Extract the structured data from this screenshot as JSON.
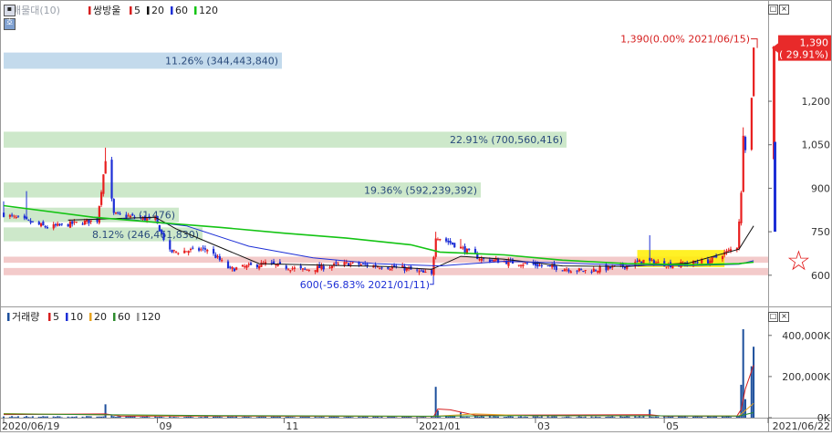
{
  "chart_data": [
    {
      "type": "candlestick",
      "panel": "price",
      "legend": [
        {
          "label": "매물대(10)",
          "color": "#9aa0aa"
        },
        {
          "label": "쌍방울",
          "color": "#d61f1f"
        },
        {
          "label": "5",
          "color": "#d61f1f"
        },
        {
          "label": "20",
          "color": "#111111"
        },
        {
          "label": "60",
          "color": "#1d2fd6"
        },
        {
          "label": "120",
          "color": "#14c414"
        }
      ],
      "y_axis": {
        "ticks": [
          600,
          750,
          900,
          1050,
          1200
        ],
        "tick_labels": [
          "600",
          "750",
          "900",
          "1,050",
          "1,200"
        ],
        "ylim": [
          505,
          1480
        ]
      },
      "x_axis": {
        "range": [
          "2020/06/19",
          "2021/06/22"
        ],
        "ticks": [
          {
            "date": "2020/06/19",
            "label": "2020/06/19"
          },
          {
            "date": "2020/09/01",
            "label": "09"
          },
          {
            "date": "2020/11/01",
            "label": "11"
          },
          {
            "date": "2021/01/04",
            "label": "2021/01"
          },
          {
            "date": "2021/03/02",
            "label": "03"
          },
          {
            "date": "2021/05/03",
            "label": "05"
          },
          {
            "date": "2021/06/22",
            "label": "2021/06/22"
          }
        ]
      },
      "volume_profile": [
        {
          "label": "11.26% (344,443,840)",
          "price_range": [
            1312,
            1368
          ],
          "color": "#bcd6ea"
        },
        {
          "label": "22.91% (700,560,416)",
          "price_range": [
            1040,
            1095
          ],
          "color": "#c8e6c4"
        },
        {
          "label": "19.36% (592,239,392)",
          "price_range": [
            868,
            920
          ],
          "color": "#c8e6c4"
        },
        {
          "label": "(1,476)",
          "price_range": [
            783,
            833
          ],
          "color": "#c8e6c4"
        },
        {
          "label": "8.12% (246,461,830)",
          "price_range": [
            717,
            765
          ],
          "color": "#c8e6c4"
        },
        {
          "label": "",
          "price_range": [
            643,
            664
          ],
          "color": "#f2c4c4"
        },
        {
          "label": "",
          "price_range": [
            600,
            625
          ],
          "color": "#f2c4c4"
        }
      ],
      "highlight_zone": {
        "label": "",
        "x_range": [
          "2021/04/20",
          "2021/06/01"
        ],
        "price_range": [
          628,
          687
        ],
        "color": "#ffee00"
      },
      "annotations": [
        {
          "text": "1,390(0.00% 2021/06/15)",
          "date": "2021/06/15",
          "price": 1390,
          "color": "#d61f1f"
        },
        {
          "text": "600(-56.83% 2021/01/11)",
          "date": "2021/01/11",
          "price": 600,
          "color": "#1d2fd6"
        },
        {
          "text": "",
          "date": "2021/06/10",
          "price": 1110,
          "color": "#d61f1f"
        }
      ],
      "last_price": {
        "value": "1,390",
        "change": "( 29.91%)",
        "price": 1390,
        "color": "#e82a2a"
      },
      "prior_range_bars": [
        {
          "from": 1000,
          "to": 1390,
          "color": "#e82a2a"
        },
        {
          "from": 750,
          "to": 1060,
          "color": "#1d2fd6"
        }
      ],
      "price_keyframes": [
        [
          "2020/06/19",
          810
        ],
        [
          "2020/07/10",
          765
        ],
        [
          "2020/08/03",
          790
        ],
        [
          "2020/08/07",
          1000
        ],
        [
          "2020/08/11",
          810
        ],
        [
          "2020/08/31",
          790
        ],
        [
          "2020/09/07",
          680
        ],
        [
          "2020/09/25",
          690
        ],
        [
          "2020/10/06",
          620
        ],
        [
          "2020/10/23",
          640
        ],
        [
          "2020/11/10",
          618
        ],
        [
          "2020/12/01",
          640
        ],
        [
          "2020/12/28",
          625
        ],
        [
          "2021/01/11",
          600
        ],
        [
          "2021/01/13",
          735
        ],
        [
          "2021/01/25",
          695
        ],
        [
          "2021/02/04",
          655
        ],
        [
          "2021/02/25",
          640
        ],
        [
          "2021/03/10",
          628
        ],
        [
          "2021/03/25",
          615
        ],
        [
          "2021/04/13",
          630
        ],
        [
          "2021/04/23",
          650
        ],
        [
          "2021/05/07",
          635
        ],
        [
          "2021/05/24",
          648
        ],
        [
          "2021/06/02",
          680
        ],
        [
          "2021/06/07",
          700
        ],
        [
          "2021/06/09",
          880
        ],
        [
          "2021/06/10",
          1090
        ],
        [
          "2021/06/11",
          1040
        ],
        [
          "2021/06/14",
          1210
        ],
        [
          "2021/06/15",
          1390
        ]
      ],
      "price_spikes": [
        {
          "date": "2020/06/19",
          "high": 855
        },
        {
          "date": "2020/06/30",
          "high": 890
        },
        {
          "date": "2020/08/07",
          "high": 1040
        },
        {
          "date": "2021/01/13",
          "high": 750
        },
        {
          "date": "2021/01/25",
          "high": 725
        },
        {
          "date": "2021/04/26",
          "high": 738
        },
        {
          "date": "2021/06/10",
          "high": 1110
        }
      ],
      "moving_averages": [
        {
          "period": 20,
          "color": "#111111",
          "keyframes": [
            [
              "2020/07/20",
              790
            ],
            [
              "2020/08/31",
              800
            ],
            [
              "2020/09/10",
              760
            ],
            [
              "2020/09/30",
              700
            ],
            [
              "2020/10/20",
              640
            ],
            [
              "2020/11/20",
              635
            ],
            [
              "2020/12/20",
              630
            ],
            [
              "2021/01/11",
              620
            ],
            [
              "2021/01/25",
              665
            ],
            [
              "2021/02/15",
              655
            ],
            [
              "2021/03/15",
              632
            ],
            [
              "2021/04/15",
              630
            ],
            [
              "2021/05/15",
              642
            ],
            [
              "2021/06/08",
              690
            ],
            [
              "2021/06/15",
              770
            ]
          ]
        },
        {
          "period": 60,
          "color": "#1d2fd6",
          "keyframes": [
            [
              "2020/08/15",
              795
            ],
            [
              "2020/09/15",
              770
            ],
            [
              "2020/10/15",
              700
            ],
            [
              "2020/11/15",
              660
            ],
            [
              "2020/12/15",
              640
            ],
            [
              "2021/01/15",
              632
            ],
            [
              "2021/02/15",
              648
            ],
            [
              "2021/03/15",
              642
            ],
            [
              "2021/04/15",
              635
            ],
            [
              "2021/05/15",
              633
            ],
            [
              "2021/06/08",
              638
            ],
            [
              "2021/06/15",
              650
            ]
          ]
        },
        {
          "period": 120,
          "color": "#14c414",
          "keyframes": [
            [
              "2020/06/19",
              840
            ],
            [
              "2020/08/01",
              800
            ],
            [
              "2020/09/01",
              782
            ],
            [
              "2020/10/01",
              765
            ],
            [
              "2020/11/01",
              745
            ],
            [
              "2020/12/01",
              728
            ],
            [
              "2021/01/01",
              705
            ],
            [
              "2021/01/15",
              680
            ],
            [
              "2021/02/15",
              670
            ],
            [
              "2021/03/15",
              652
            ],
            [
              "2021/04/15",
              640
            ],
            [
              "2021/05/15",
              636
            ],
            [
              "2021/06/08",
              640
            ],
            [
              "2021/06/15",
              645
            ]
          ]
        }
      ]
    },
    {
      "type": "bar",
      "panel": "volume",
      "legend": [
        {
          "label": "거래량",
          "color": "#1d4f9c"
        },
        {
          "label": "5",
          "color": "#d61f1f"
        },
        {
          "label": "10",
          "color": "#1d2fd6"
        },
        {
          "label": "20",
          "color": "#e6a21e"
        },
        {
          "label": "60",
          "color": "#2e8b2e"
        },
        {
          "label": "120",
          "color": "#999999"
        }
      ],
      "y_axis": {
        "ticks": [
          0,
          200000,
          400000
        ],
        "tick_labels": [
          "0K",
          "200,000K",
          "400,000K"
        ],
        "ylim": [
          0,
          470000
        ]
      },
      "baseline": 5000,
      "spikes": [
        {
          "date": "2020/08/07",
          "value": 65000
        },
        {
          "date": "2020/08/10",
          "value": 12000
        },
        {
          "date": "2021/01/13",
          "value": 150000
        },
        {
          "date": "2021/01/14",
          "value": 35000
        },
        {
          "date": "2021/01/25",
          "value": 25000
        },
        {
          "date": "2021/04/26",
          "value": 40000
        },
        {
          "date": "2021/06/09",
          "value": 160000
        },
        {
          "date": "2021/06/10",
          "value": 430000
        },
        {
          "date": "2021/06/11",
          "value": 90000
        },
        {
          "date": "2021/06/14",
          "value": 250000
        },
        {
          "date": "2021/06/15",
          "value": 345000
        }
      ],
      "moving_averages": [
        {
          "period": 5,
          "color": "#d61f1f",
          "keyframes": [
            [
              "2020/06/19",
              15000
            ],
            [
              "2020/08/07",
              18000
            ],
            [
              "2020/08/14",
              8000
            ],
            [
              "2021/01/12",
              6000
            ],
            [
              "2021/01/14",
              42000
            ],
            [
              "2021/01/20",
              38000
            ],
            [
              "2021/02/01",
              12000
            ],
            [
              "2021/04/26",
              14000
            ],
            [
              "2021/05/03",
              7000
            ],
            [
              "2021/06/07",
              8000
            ],
            [
              "2021/06/09",
              40000
            ],
            [
              "2021/06/11",
              140000
            ],
            [
              "2021/06/15",
              255000
            ]
          ]
        },
        {
          "period": 20,
          "color": "#e6a21e",
          "keyframes": [
            [
              "2020/06/19",
              20000
            ],
            [
              "2020/09/01",
              10000
            ],
            [
              "2021/01/11",
              6000
            ],
            [
              "2021/02/01",
              18000
            ],
            [
              "2021/03/01",
              9000
            ],
            [
              "2021/06/08",
              9000
            ],
            [
              "2021/06/15",
              70000
            ]
          ]
        },
        {
          "period": 60,
          "color": "#2e8b2e",
          "keyframes": [
            [
              "2020/06/19",
              18000
            ],
            [
              "2020/10/01",
              10000
            ],
            [
              "2021/01/11",
              7000
            ],
            [
              "2021/03/01",
              10000
            ],
            [
              "2021/06/08",
              8000
            ],
            [
              "2021/06/15",
              25000
            ]
          ]
        }
      ]
    }
  ]
}
